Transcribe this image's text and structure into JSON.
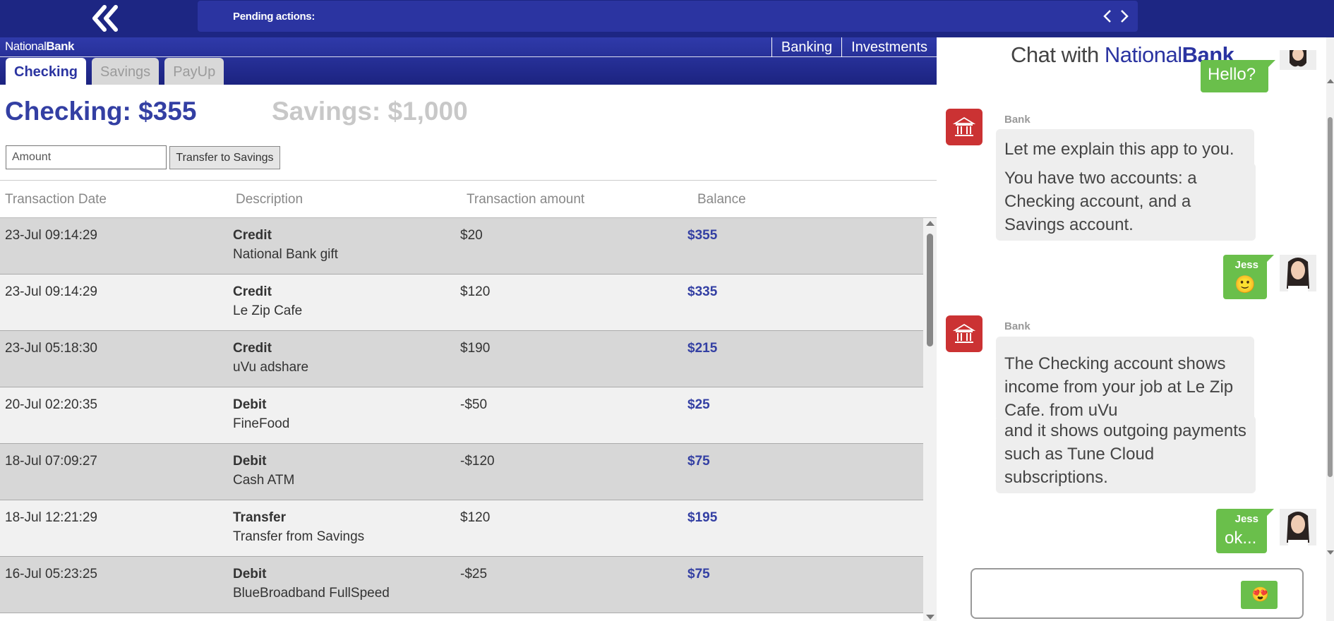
{
  "topbar": {
    "pending_label": "Pending actions:"
  },
  "bank": {
    "brand_light": "National",
    "brand_bold": "Bank",
    "nav": [
      "Banking",
      "Investments"
    ],
    "tabs": [
      "Checking",
      "Savings",
      "PayUp"
    ]
  },
  "balances": {
    "checking": "Checking: $355",
    "savings": "Savings: $1,000"
  },
  "transfer": {
    "amount_placeholder": "Amount",
    "button_label": "Transfer to Savings"
  },
  "table": {
    "headers": [
      "Transaction Date",
      "Description",
      "Transaction amount",
      "Balance"
    ],
    "rows": [
      {
        "date": "23-Jul 09:14:29",
        "type": "Credit",
        "description": "National Bank gift",
        "amount": "$20",
        "balance": "$355"
      },
      {
        "date": "23-Jul 09:14:29",
        "type": "Credit",
        "description": "Le Zip Cafe",
        "amount": "$120",
        "balance": "$335"
      },
      {
        "date": "23-Jul 05:18:30",
        "type": "Credit",
        "description": "uVu adshare",
        "amount": "$190",
        "balance": "$215"
      },
      {
        "date": "20-Jul 02:20:35",
        "type": "Debit",
        "description": "FineFood",
        "amount": "-$50",
        "balance": "$25"
      },
      {
        "date": "18-Jul 07:09:27",
        "type": "Debit",
        "description": "Cash ATM",
        "amount": "-$120",
        "balance": "$75"
      },
      {
        "date": "18-Jul 12:21:29",
        "type": "Transfer",
        "description": "Transfer from Savings",
        "amount": "$120",
        "balance": "$195"
      },
      {
        "date": "16-Jul 05:23:25",
        "type": "Debit",
        "description": "BlueBroadband FullSpeed",
        "amount": "-$25",
        "balance": "$75"
      }
    ]
  },
  "chat": {
    "title_prefix": "Chat with ",
    "title_brand_light": "National",
    "title_brand_bold": "Bank",
    "messages": {
      "user_hello": "Hello?",
      "bank1_sender": "Bank",
      "bank1_msg1": "Let me explain this app to you.",
      "bank1_msg2": "You have two accounts: a Checking account, and a Savings account.",
      "user1_name": "Jess",
      "user1_text": "🙂",
      "bank2_sender": "Bank",
      "bank2_msg1": "The Checking account shows income from your job at Le Zip Cafe, from uVu",
      "bank2_msg2": "and it shows outgoing payments such as Tune Cloud subscriptions.",
      "user2_name": "Jess",
      "user2_text": "ok..."
    },
    "emoji_button": "😍"
  },
  "colors": {
    "navy": "#1d2683",
    "accent": "#2b34a1",
    "bank_red": "#cb3233",
    "user_green": "#6abf4b"
  }
}
